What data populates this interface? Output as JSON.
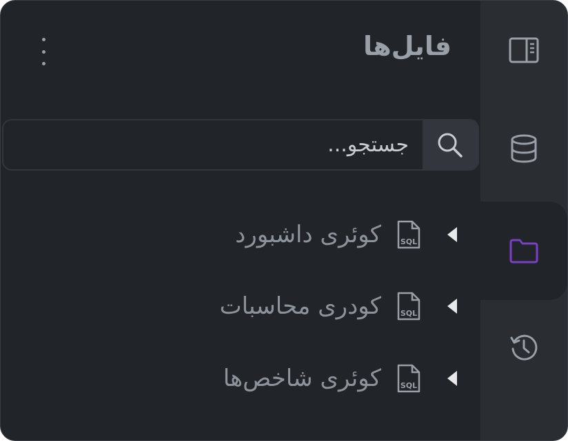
{
  "panel": {
    "title": "فایل‌ها",
    "menu_icon": "kebab-vertical-icon"
  },
  "search": {
    "placeholder": "جستجو...",
    "icon": "search-icon"
  },
  "rail": {
    "items": [
      {
        "icon": "sidebar-panel-icon",
        "active": false
      },
      {
        "icon": "database-icon",
        "active": false
      },
      {
        "icon": "folder-icon",
        "active": true
      },
      {
        "icon": "history-icon",
        "active": false
      }
    ],
    "active_color": "#7b3fc4"
  },
  "files": [
    {
      "label": "کوئری داشبورد",
      "icon": "sql-file-icon",
      "icon_text": "SQL",
      "expand_icon": "caret-left-icon"
    },
    {
      "label": "کودری محاسبات",
      "icon": "sql-file-icon",
      "icon_text": "SQL",
      "expand_icon": "caret-left-icon"
    },
    {
      "label": "کوئری شاخص‌ها",
      "icon": "sql-file-icon",
      "icon_text": "SQL",
      "expand_icon": "caret-left-icon"
    }
  ]
}
